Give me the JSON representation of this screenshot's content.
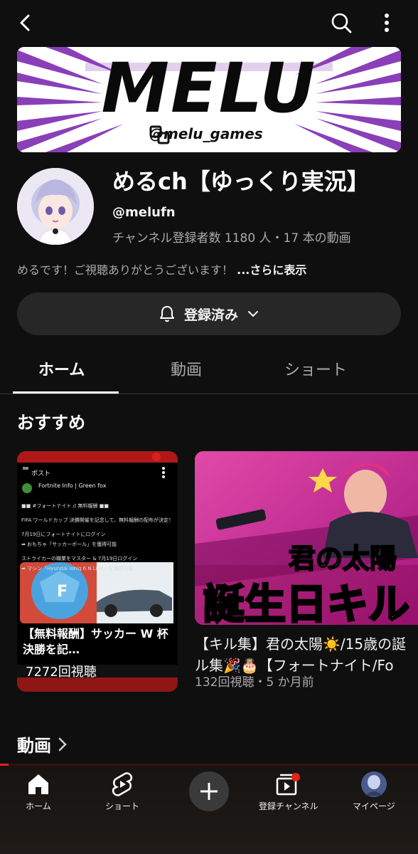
{
  "banner": {
    "title": "MELU",
    "handle": "@melu_games"
  },
  "channel": {
    "name": "めるch【ゆっくり実況】",
    "handle": "@melufn",
    "stats": "チャンネル登録者数 1180 人・17 本の動画",
    "description": "めるです！ご視聴ありがとうございます！",
    "more_label": "...さらに表示"
  },
  "subscribe": {
    "label": "登録済み"
  },
  "tabs": [
    {
      "label": "ホーム",
      "active": true
    },
    {
      "label": "動画",
      "active": false
    },
    {
      "label": "ショート",
      "active": false
    }
  ],
  "recommended": {
    "title": "おすすめ",
    "cards": [
      {
        "thumb_header": "ポスト",
        "thumb_account": "Fortnite Info | Green fox",
        "thumb_lines": [
          "■■ #フォートナイト // 無料報酬 ■■",
          "FIFA ワールドカップ 決勝開催を記念して、無料報酬の配布が決定！",
          "7月19日にフォートナイトにログイン",
          "➡ おもちゃ「サッカーボール」を獲得可能",
          "ストライカーの職業をマスター & 7月19日ログイン",
          "➡ マシン「Hyundai Ioniq 6 N Line」を獲得可能"
        ],
        "caption": "【無料報酬】サッカー W 杯決勝を記…",
        "views": "7272回視聴"
      },
      {
        "thumb_text_top": "君の太陽",
        "thumb_text_bottom": "誕生日キル",
        "title_line1": "【キル集】君の太陽☀️/15歳の誕",
        "title_line2": "ル集🎉🎂【フォートナイト/Fo",
        "meta": "132回視聴・5 か月前"
      }
    ]
  },
  "videos_section": {
    "title": "動画"
  },
  "progress": {
    "fraction": 0.02
  },
  "bottom_nav": [
    {
      "label": "ホーム",
      "icon": "home-icon"
    },
    {
      "label": "ショート",
      "icon": "shorts-icon"
    },
    {
      "label": "",
      "icon": "plus-icon"
    },
    {
      "label": "登録チャンネル",
      "icon": "subscriptions-icon"
    },
    {
      "label": "マイページ",
      "icon": "profile-avatar"
    }
  ],
  "colors": {
    "accent": "#e62117",
    "background": "#0f0f0f",
    "banner_purple": "#8a3fb8"
  }
}
